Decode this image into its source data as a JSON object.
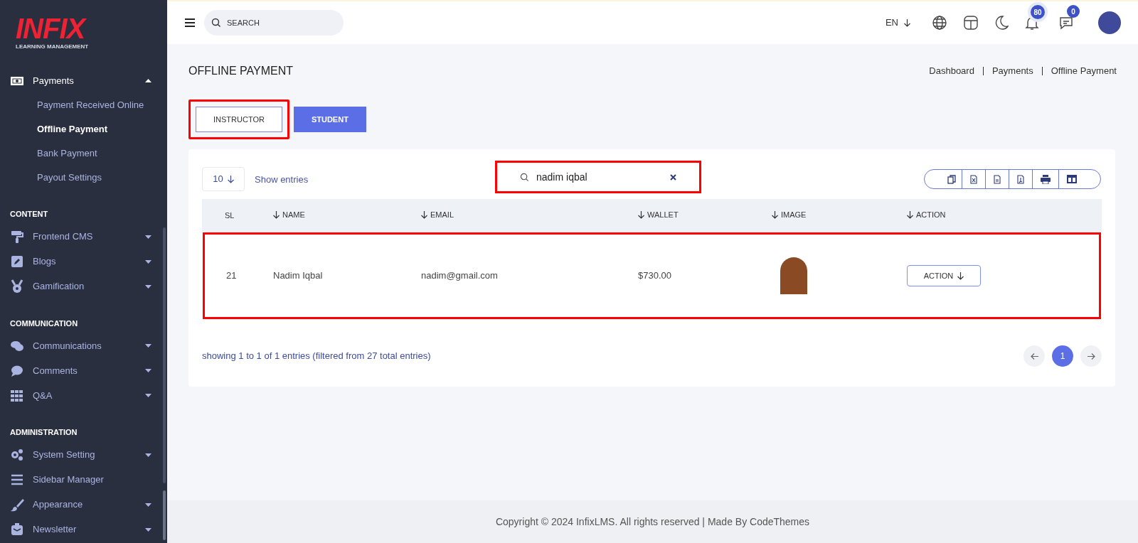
{
  "logo": {
    "word": "INFIX",
    "tagline": "LEARNING MANAGEMENT"
  },
  "sidebar": {
    "sections": [
      {
        "items": [
          {
            "label": "Payments",
            "expanded": true,
            "children": [
              {
                "label": "Payment Received Online",
                "selected": false
              },
              {
                "label": "Offline Payment",
                "selected": true
              },
              {
                "label": "Bank Payment",
                "selected": false
              },
              {
                "label": "Payout Settings",
                "selected": false
              }
            ]
          }
        ]
      },
      {
        "heading": "CONTENT",
        "items": [
          {
            "label": "Frontend CMS",
            "expanded": false
          },
          {
            "label": "Blogs",
            "expanded": false
          },
          {
            "label": "Gamification",
            "expanded": false
          }
        ]
      },
      {
        "heading": "COMMUNICATION",
        "items": [
          {
            "label": "Communications",
            "expanded": false
          },
          {
            "label": "Comments",
            "expanded": false
          },
          {
            "label": "Q&A",
            "expanded": false
          }
        ]
      },
      {
        "heading": "ADMINISTRATION",
        "items": [
          {
            "label": "System Setting",
            "expanded": false
          },
          {
            "label": "Sidebar Manager"
          },
          {
            "label": "Appearance",
            "expanded": false
          },
          {
            "label": "Newsletter",
            "expanded": false
          }
        ]
      }
    ]
  },
  "topbar": {
    "search_placeholder": "SEARCH",
    "language": "EN",
    "notifications": "80",
    "messages": "0"
  },
  "page": {
    "title": "OFFLINE PAYMENT",
    "breadcrumb": [
      "Dashboard",
      "Payments",
      "Offline Payment"
    ]
  },
  "tabs": [
    {
      "label": "INSTRUCTOR",
      "selected": false,
      "highlighted": true
    },
    {
      "label": "STUDENT",
      "selected": true,
      "highlighted": false
    }
  ],
  "table": {
    "page_size": "10",
    "show_entries": "Show entries",
    "search": {
      "value": "nadim iqbal",
      "highlighted": true
    },
    "columns": [
      "SL",
      "NAME",
      "EMAIL",
      "WALLET",
      "IMAGE",
      "ACTION"
    ],
    "rows": [
      {
        "sl": "21",
        "name": "Nadim Iqbal",
        "email": "nadim@gmail.com",
        "wallet": "$730.00",
        "action": "ACTION",
        "highlighted": true
      }
    ],
    "info": "showing 1 to 1 of 1 entries (filtered from 27 total entries)",
    "pages": [
      {
        "label": "1",
        "selected": true
      }
    ]
  },
  "footer": "Copyright © 2024 InfixLMS. All rights reserved | Made By CodeThemes"
}
